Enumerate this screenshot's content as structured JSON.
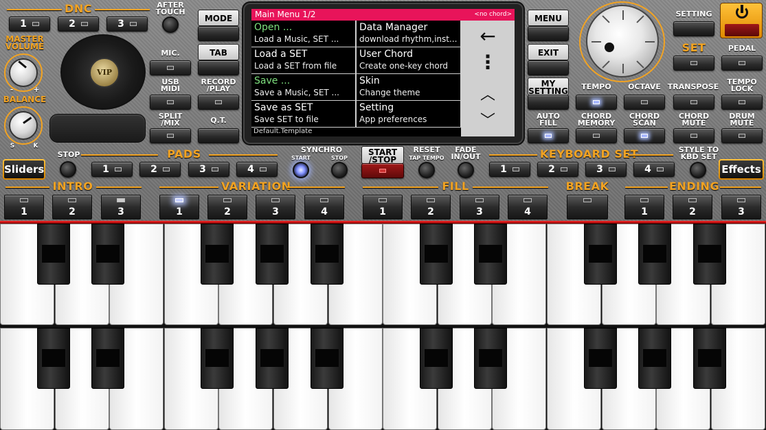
{
  "dnc": {
    "title": "DNC",
    "buttons": [
      "1",
      "2",
      "3"
    ],
    "after_touch": "AFTER\nTOUCH"
  },
  "master_volume": {
    "label": "MASTER\nVOLUME",
    "min": "-",
    "max": "+"
  },
  "balance": {
    "label": "BALANCE",
    "left": "S",
    "right": "K"
  },
  "logo_text": "VIP",
  "left_buttons": {
    "mic": "MIC.",
    "usb_midi": "USB\nMIDI",
    "split_mix": "SPLIT\n/MIX"
  },
  "mid_left_buttons": {
    "mode": "MODE",
    "tab": "TAB",
    "record_play": "RECORD\n/PLAY",
    "qt": "Q.T."
  },
  "screen": {
    "header_title": "Main Menu  1/2",
    "header_chord": "<no chord>",
    "items": [
      {
        "title": "Open ...",
        "subtitle": "Load a Music, SET ..."
      },
      {
        "title": "Data Manager",
        "subtitle": "download rhythm,inst..."
      },
      {
        "title": "Load a SET",
        "subtitle": "Load a SET from file"
      },
      {
        "title": "User Chord",
        "subtitle": "Create one-key chord"
      },
      {
        "title": "Save ...",
        "subtitle": "Save a Music, SET ..."
      },
      {
        "title": "Skin",
        "subtitle": "Change theme"
      },
      {
        "title": "Save as SET",
        "subtitle": "Save SET to file"
      },
      {
        "title": "Setting",
        "subtitle": "App preferences"
      }
    ],
    "footer": "Default.Template",
    "nav": {
      "back": "←",
      "more": "⋮",
      "up": "︿",
      "down": "﹀"
    }
  },
  "right_buttons": {
    "menu": "MENU",
    "exit": "EXIT",
    "my_setting": "MY\nSETTING",
    "auto_fill": "AUTO\nFILL"
  },
  "far_right": {
    "setting": "SETTING",
    "set": "SET",
    "pedal": "PEDAL"
  },
  "row3_labels": {
    "tempo": "TEMPO",
    "octave": "OCTAVE",
    "transpose": "TRANSPOSE",
    "tempo_lock": "TEMPO\nLOCK"
  },
  "row4_labels": {
    "chord_memory": "CHORD\nMEMORY",
    "chord_scan": "CHORD\nSCAN",
    "chord_mute": "CHORD\nMUTE",
    "drum_mute": "DRUM\nMUTE"
  },
  "pads": {
    "title": "PADS",
    "stop": "STOP",
    "buttons": [
      "1",
      "2",
      "3",
      "4"
    ]
  },
  "synchro": {
    "title": "SYNCHRO",
    "start": "START",
    "stop": "STOP"
  },
  "start_stop": "START\n/STOP",
  "reset": {
    "label": "RESET",
    "sub": "TAP TEMPO"
  },
  "fade": "FADE\nIN/OUT",
  "keyboard_set": {
    "title": "KEYBOARD SET",
    "buttons": [
      "1",
      "2",
      "3",
      "4"
    ],
    "style_to_kbd": "STYLE TO\nKBD SET"
  },
  "sliders_button": "Sliders",
  "effects_button": "Effects",
  "sections": {
    "intro": {
      "title": "INTRO",
      "buttons": [
        "1",
        "2",
        "3"
      ]
    },
    "variation": {
      "title": "VARIATION",
      "buttons": [
        "1",
        "2",
        "3",
        "4"
      ]
    },
    "fill": {
      "title": "FILL",
      "buttons": [
        "1",
        "2",
        "3",
        "4"
      ]
    },
    "break": {
      "title": "BREAK"
    },
    "ending": {
      "title": "ENDING",
      "buttons": [
        "1",
        "2",
        "3"
      ]
    }
  },
  "colors": {
    "accent": "#f2a322",
    "screen_header": "#e8145a",
    "led_on": "#a7b7ff",
    "power": "#f5a623"
  }
}
